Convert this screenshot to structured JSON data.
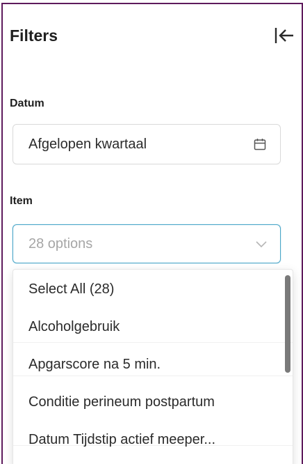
{
  "panel": {
    "title": "Filters",
    "collapse_icon": "collapse-left-icon"
  },
  "datum": {
    "label": "Datum",
    "value": "Afgelopen kwartaal",
    "icon": "calendar-icon"
  },
  "item": {
    "label": "Item",
    "placeholder": "28 options",
    "icon": "chevron-down-icon",
    "options": [
      "Select All (28)",
      "Alcoholgebruik",
      "Apgarscore na 5 min.",
      "Conditie perineum postpartum",
      "Datum Tijdstip actief meeper..."
    ]
  },
  "colors": {
    "frame_border": "#5e1a5c",
    "select_focus_border": "#4aa6c8"
  }
}
